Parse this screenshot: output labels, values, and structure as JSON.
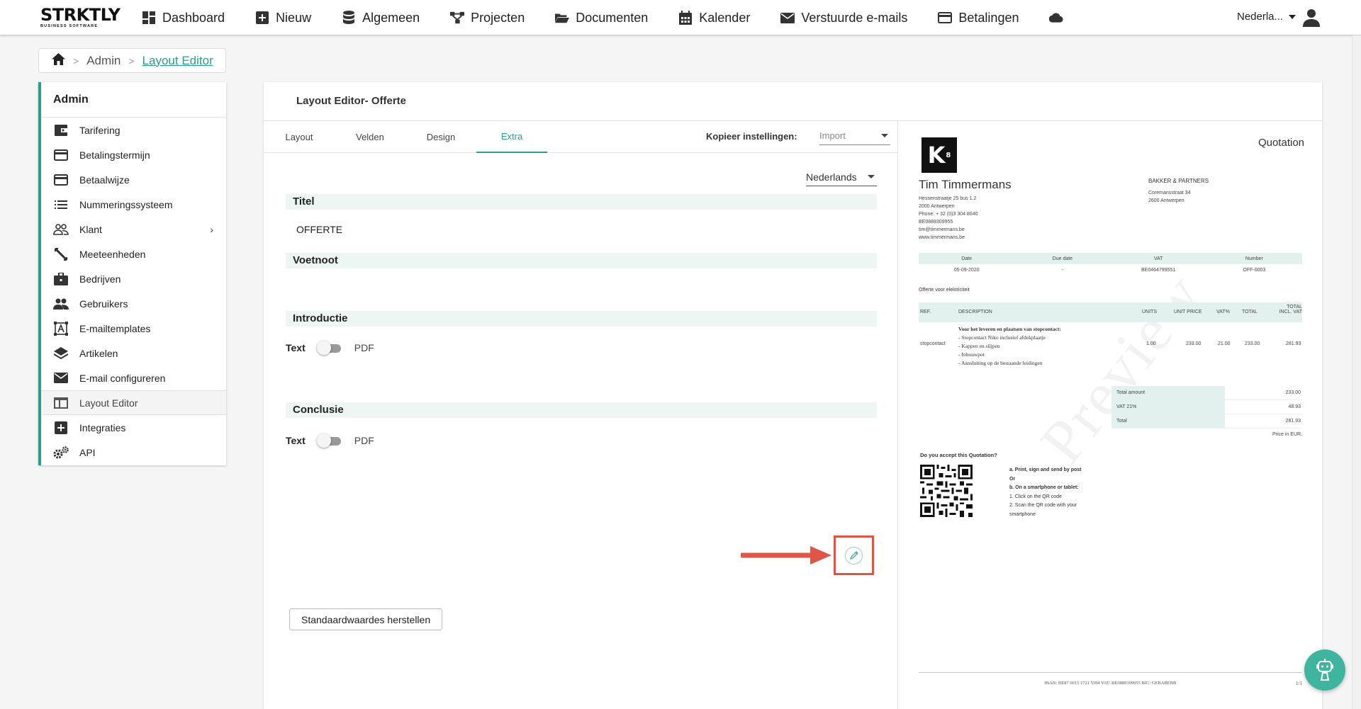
{
  "brand": {
    "name": "STRKTLY",
    "tagline": "BUSINESS SOFTWARE"
  },
  "nav": {
    "items": [
      {
        "label": "Dashboard",
        "icon": "dashboard-icon"
      },
      {
        "label": "Nieuw",
        "icon": "plus-square-icon"
      },
      {
        "label": "Algemeen",
        "icon": "database-icon"
      },
      {
        "label": "Projecten",
        "icon": "project-tree-icon"
      },
      {
        "label": "Documenten",
        "icon": "folder-open-icon"
      },
      {
        "label": "Kalender",
        "icon": "calendar-icon"
      },
      {
        "label": "Verstuurde e-mails",
        "icon": "envelope-icon"
      },
      {
        "label": "Betalingen",
        "icon": "credit-card-icon"
      }
    ],
    "cloud_icon": "cloud-icon",
    "language": "Nederla...",
    "user_icon": "user-icon"
  },
  "breadcrumb": {
    "home_icon": "home-icon",
    "admin": "Admin",
    "current": "Layout Editor"
  },
  "sidebar": {
    "title": "Admin",
    "items": [
      {
        "label": "Tarifering",
        "icon": "wallet-icon"
      },
      {
        "label": "Betalingstermijn",
        "icon": "credit-card-icon"
      },
      {
        "label": "Betaalwijze",
        "icon": "credit-card-icon"
      },
      {
        "label": "Nummeringssysteem",
        "icon": "list-icon"
      },
      {
        "label": "Klant",
        "icon": "people-outline-icon"
      },
      {
        "label": "Meeteenheden",
        "icon": "ruler-icon"
      },
      {
        "label": "Bedrijven",
        "icon": "briefcase-icon"
      },
      {
        "label": "Gebruikers",
        "icon": "people-icon"
      },
      {
        "label": "E-mailtemplates",
        "icon": "template-icon"
      },
      {
        "label": "Artikelen",
        "icon": "layers-icon"
      },
      {
        "label": "E-mail configureren",
        "icon": "envelope-icon"
      },
      {
        "label": "Layout Editor",
        "icon": "layout-icon"
      },
      {
        "label": "Integraties",
        "icon": "plus-square-icon"
      },
      {
        "label": "API",
        "icon": "gears-icon"
      }
    ],
    "active": "Layout Editor",
    "klant_chevron": "›"
  },
  "editor": {
    "title": "Layout Editor- Offerte",
    "tabs": [
      "Layout",
      "Velden",
      "Design",
      "Extra"
    ],
    "active_tab": "Extra",
    "kopieer_label": "Kopieer instellingen:",
    "import_placeholder": "Import",
    "language": "Nederlands",
    "sections": {
      "titel": {
        "heading": "Titel",
        "value": "OFFERTE"
      },
      "voetnoot": {
        "heading": "Voetnoot",
        "value": ""
      },
      "introductie": {
        "heading": "Introductie",
        "toggle_left": "Text",
        "toggle_right": "PDF"
      },
      "conclusie": {
        "heading": "Conclusie",
        "toggle_left": "Text",
        "toggle_right": "PDF"
      }
    },
    "reset_button": "Standaardwaardes herstellen",
    "annotation_color": "#e05545"
  },
  "preview": {
    "doc_title": "Quotation",
    "logo_text": "K",
    "logo_sub": "8",
    "sender": {
      "name": "Tim Timmermans",
      "address_lines": [
        "Hessenstraatje 25 bus 1.2",
        "2000 Antwerpen",
        "Phone: + 32 (0)3 304 8040",
        "BE0889309955",
        "tim@timmermans.be",
        "www.timmermans.be"
      ]
    },
    "client": {
      "name": "BAKKER & PARTNERS",
      "address_lines": [
        "Coremansstraat 34",
        "2600 Antwerpen"
      ]
    },
    "meta_headers": [
      "Date",
      "Due date",
      "VAT",
      "Number"
    ],
    "meta_values": [
      "05-09-2020",
      "-",
      "BE0464799551",
      "OFF-0003"
    ],
    "subject": "Offerte voor elektriciteit",
    "line_headers": {
      "ref": "REF.",
      "description": "DESCRIPTION",
      "units": "UNITS",
      "unit_price": "UNIT PRICE",
      "vat": "VAT%",
      "total": "TOTAL",
      "total_incl": "TOTAL INCL. VAT"
    },
    "line": {
      "ref": "stopcontact",
      "desc_lines": [
        "Voor het leveren en plaatsen van stopcontact:",
        "- Stopcontact Niko inclusief afdekplaatje",
        "- Kappen en slijpen",
        "- Inbouwpot",
        "- Aansluiting op de bestaande leidingen"
      ],
      "units": "1.00",
      "unit_price": "233.00",
      "vat": "21.00",
      "total": "233.00",
      "total_incl": "281.93"
    },
    "totals": [
      {
        "label": "Total amount",
        "value": "233.00"
      },
      {
        "label": "VAT 21%",
        "value": "48.93"
      },
      {
        "label": "Total",
        "value": "281.93"
      }
    ],
    "price_note": "Price in EUR.",
    "accept_title": "Do you accept this Quotation?",
    "steps": [
      "a. Print, sign and send by post",
      "Or",
      "b. On a smartphone or tablet:",
      "1. Click on the QR code",
      "2. Scan the QR code with your",
      "smartphone"
    ],
    "watermark": "Preview",
    "footer": "IBAN: BE87 0015 1721 5594    VAT: BE0889309955    BIC: GEBABEBB",
    "page": "1/1"
  },
  "colors": {
    "accent": "#2a9d8f",
    "section_bg": "#eef6f4",
    "help": "#3fb59f"
  }
}
